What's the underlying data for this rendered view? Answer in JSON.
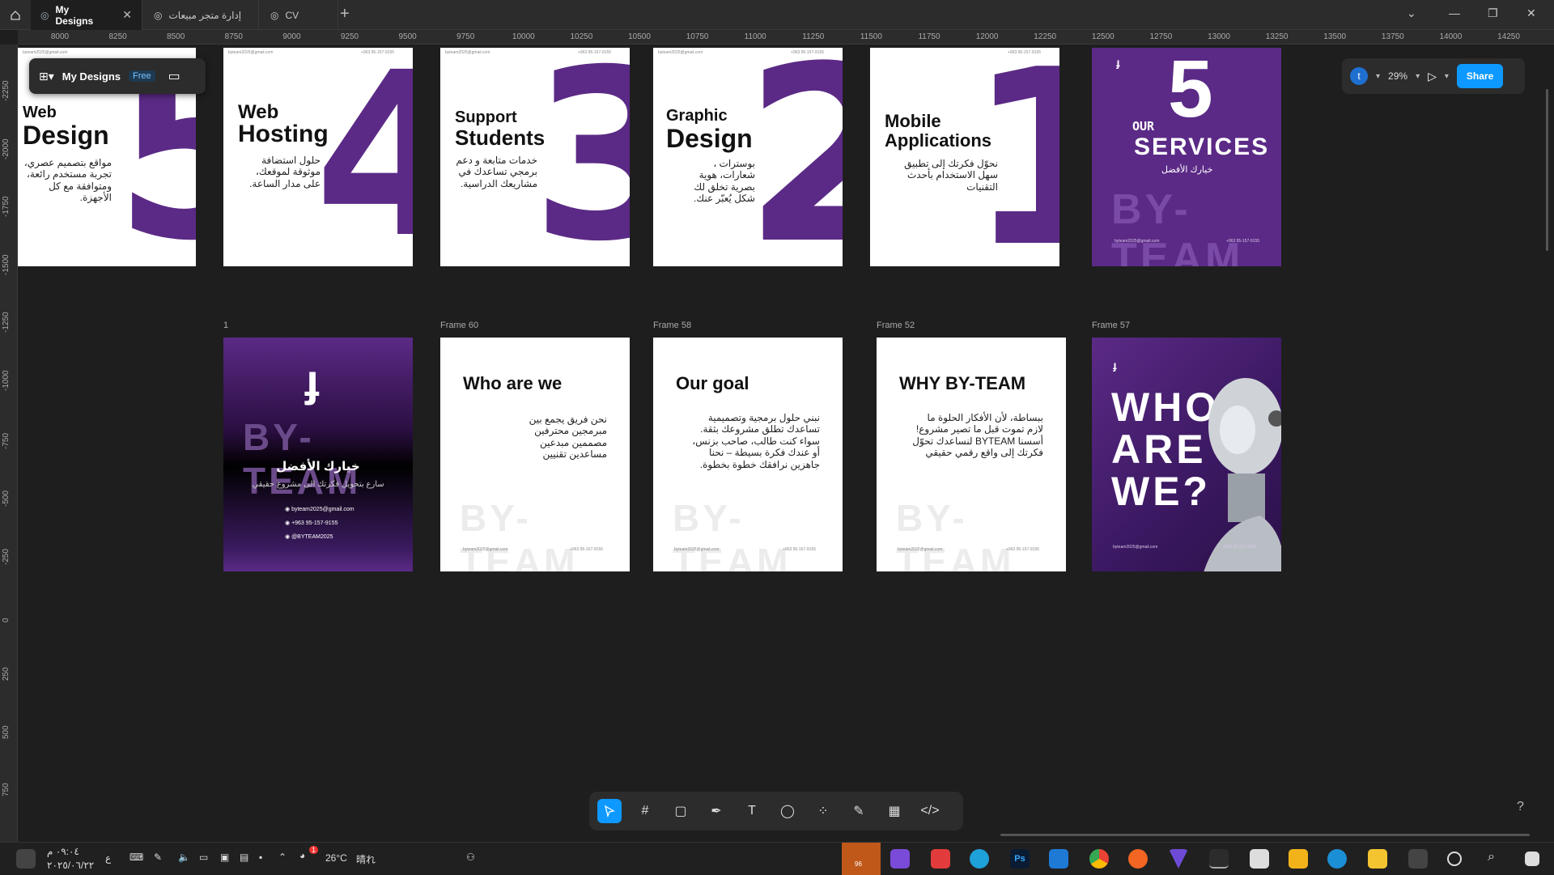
{
  "tabs": [
    {
      "label": "My Designs",
      "active": true
    },
    {
      "label": "إدارة متجر مبيعات",
      "active": false
    },
    {
      "label": "CV",
      "active": false
    }
  ],
  "ruler_h": [
    "8000",
    "8250",
    "8500",
    "8750",
    "9000",
    "9250",
    "9500",
    "9750",
    "10000",
    "10250",
    "10500",
    "10750",
    "11000",
    "11250",
    "11500",
    "11750",
    "12000",
    "12250",
    "12500",
    "12750",
    "13000",
    "13250",
    "13500",
    "13750",
    "14000",
    "14250"
  ],
  "ruler_v": [
    "-2250",
    "-2000",
    "-1750",
    "-1500",
    "-1250",
    "-1000",
    "-750",
    "-500",
    "-250",
    "0",
    "250",
    "500",
    "750"
  ],
  "file_panel": {
    "title": "My Designs",
    "badge": "Free"
  },
  "right_panel": {
    "avatar": "t",
    "zoom": "29%",
    "share": "Share"
  },
  "frames_row1": [
    {
      "title_small": "Web",
      "title_big": "Design",
      "number": "5",
      "arabic": "مواقع بتصميم عصري، تجربة مستخدم رائعة، ومتوافقة مع كل الأجهزة.",
      "email": "byteam2025@gmail.com",
      "phone": "+963 95-157-9155"
    },
    {
      "title_small": "Web",
      "title_big": "Hosting",
      "number": "4",
      "arabic": "حلول استضافة موثوقة لموقعك، على مدار الساعة.",
      "email": "byteam2025@gmail.com",
      "phone": "+963 95-157-9155"
    },
    {
      "title_small": "Support",
      "title_big": "Students",
      "number": "3",
      "arabic": "خدمات متابعة و دعم برمجي تساعدك في مشاريعك الدراسية.",
      "email": "byteam2025@gmail.com",
      "phone": "+963 95-157-9155"
    },
    {
      "title_small": "Graphic",
      "title_big": "Design",
      "number": "2",
      "arabic": "بوسترات ، شعارات، هوية بصرية تخلق لك شكل يُعبّر عنك.",
      "email": "byteam2025@gmail.com",
      "phone": "+963 95-157-9155"
    },
    {
      "title_small": "Mobile",
      "title_big": "Applications",
      "number": "1",
      "arabic": "نحوّل فكرتك إلى تطبيق سهل الاستخدام بأحدث التقنيات",
      "email": "byteam2025@gmail.com",
      "phone": "+963 95-157-9155"
    }
  ],
  "services_frame": {
    "number": "5",
    "our": "OUR",
    "services": "SERVICES",
    "arabic": "خيارك الأفضل",
    "watermark": "BY-TEAM",
    "email": "byteam2025@gmail.com",
    "phone": "+963 95-157-9155"
  },
  "frames_row2_labels": [
    "1",
    "Frame 60",
    "Frame 58",
    "Frame 52",
    "Frame 57"
  ],
  "logo_frame": {
    "watermark": "BY-TEAM",
    "arabic_title": "خيارك الأفضل",
    "arabic_sub": "سارع بتحويل فكرتك الى مشروع حقيقي",
    "email": "byteam2025@gmail.com",
    "phone": "+963 95-157-9155",
    "insta": "@BYTEAM2025"
  },
  "text_frames": [
    {
      "title": "Who are we",
      "arabic": "نحن فريق يجمع بين مبرمجين محترفين مصممين مبدعين مساعدين تقنيين",
      "watermark": "BY-TEAM",
      "email": "byteam2025@gmail.com",
      "phone": "+963 95-157-9155"
    },
    {
      "title": "Our goal",
      "arabic": "نبني حلول برمجية وتصميمية تساعدك تطلق مشروعك بثقة. سواء كنت طالب، صاحب بزنس، أو عندك فكرة بسيطة – نحنا جاهزين نرافقك خطوة بخطوة.",
      "watermark": "BY-TEAM",
      "email": "byteam2025@gmail.com",
      "phone": "+963 95-157-9155"
    },
    {
      "title": "WHY BY-TEAM",
      "arabic": "ببساطة، لأن الأفكار الحلوة ما لازم تموت قبل ما تصير مشروع! أسسنا BYTEAM لنساعدك تحوّل فكرتك إلى واقع رقمي حقيقي",
      "watermark": "BY-TEAM",
      "email": "byteam2025@gmail.com",
      "phone": "+963 95-157-9155"
    }
  ],
  "robot_frame": {
    "l1": "WHO",
    "l2": "ARE",
    "l3": "WE?",
    "email": "byteam2025@gmail.com",
    "phone": "+963 95-157-9155"
  },
  "taskbar": {
    "temp": "26°C",
    "weather": "晴れ",
    "time": "٠٩:٠٤ م",
    "date": "٢٠٢٥/٠٦/٢٢",
    "lang": "ع",
    "badge": "1",
    "telegram_count": "96"
  },
  "help": "?"
}
